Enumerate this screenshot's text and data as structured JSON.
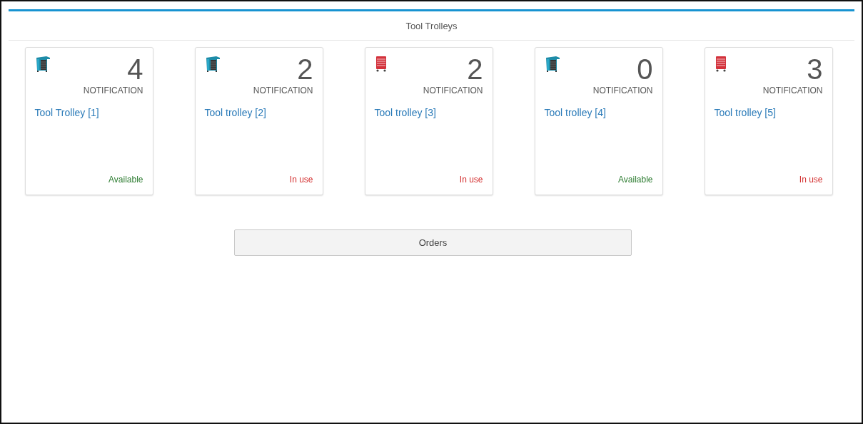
{
  "header": {
    "title": "Tool Trolleys"
  },
  "trolleys": [
    {
      "kind": "cabinet",
      "count": "4",
      "count_label": "NOTIFICATION",
      "name": "Tool Trolley [1]",
      "status": {
        "kind": "available",
        "text": "Available"
      }
    },
    {
      "kind": "cabinet",
      "count": "2",
      "count_label": "NOTIFICATION",
      "name": "Tool trolley [2]",
      "status": {
        "kind": "in_use",
        "text": "In use"
      }
    },
    {
      "kind": "chest",
      "count": "2",
      "count_label": "NOTIFICATION",
      "name": "Tool trolley [3]",
      "status": {
        "kind": "in_use",
        "text": "In use"
      }
    },
    {
      "kind": "cabinet",
      "count": "0",
      "count_label": "NOTIFICATION",
      "name": "Tool trolley [4]",
      "status": {
        "kind": "available",
        "text": "Available"
      }
    },
    {
      "kind": "chest",
      "count": "3",
      "count_label": "NOTIFICATION",
      "name": "Tool trolley [5]",
      "status": {
        "kind": "in_use",
        "text": "In use"
      }
    }
  ],
  "buttons": [
    {
      "label": "Orders"
    }
  ]
}
